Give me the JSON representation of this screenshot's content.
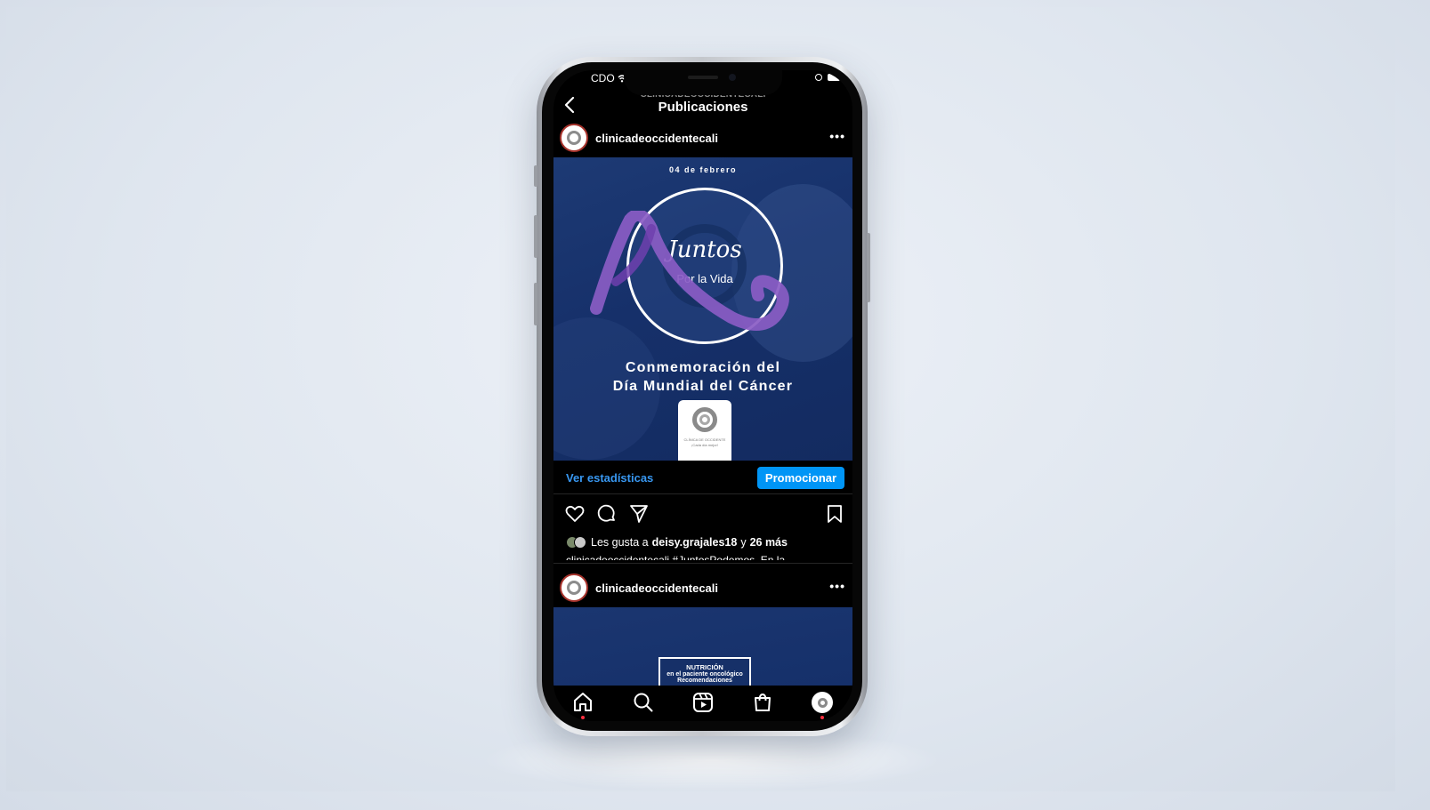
{
  "status_bar": {
    "carrier": "CDO"
  },
  "header": {
    "account_ghost": "CLINICADEOCCIDENTECALI",
    "title": "Publicaciones"
  },
  "post1": {
    "username": "clinicadeoccidentecali",
    "image": {
      "date": "04 de febrero",
      "slogan_line1": "Juntos",
      "slogan_line2": "Por la Vida",
      "headline_line1": "Conmemoración del",
      "headline_line2": "Día Mundial del Cáncer",
      "logo_caption_line1": "CLÍNICA DE OCCIDENTE",
      "logo_caption_line2": "¡Cada día mejor!"
    },
    "stats_link": "Ver estadísticas",
    "promote_button": "Promocionar",
    "likes_prefix": "Les gusta a",
    "likes_user": "deisy.grajales18",
    "likes_and": "y",
    "likes_more": "26 más",
    "caption_peek": "clinicadeoccidentecali #JuntosPodemos. En la"
  },
  "post2": {
    "username": "clinicadeoccidentecali",
    "image": {
      "card_line1": "NUTRICIÓN",
      "card_line2": "en el paciente oncológico",
      "card_line3": "Recomendaciones"
    }
  },
  "tabbar": {
    "items": [
      "home-icon",
      "search-icon",
      "reels-icon",
      "shop-icon",
      "profile-avatar"
    ]
  },
  "colors": {
    "accent_blue": "#0095f6",
    "link_blue": "#3897f0",
    "notification_red": "#ff3040",
    "post_bg": "#16306a",
    "ribbon_purple": "#8a5cc4"
  }
}
